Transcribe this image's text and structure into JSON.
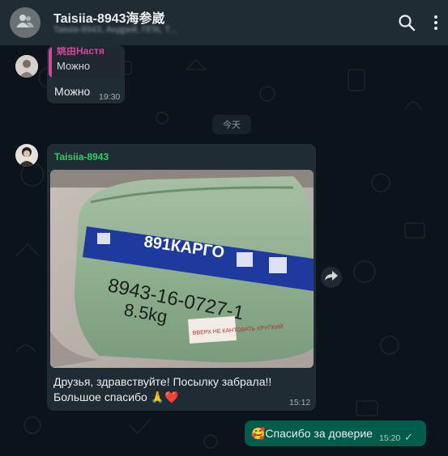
{
  "header": {
    "title": "Taisiia-8943海参崴",
    "subtitle": "Taisiia-8943, Андрей, ППК, Т..."
  },
  "icons": {
    "group_avatar": "group-icon",
    "search": "search-icon",
    "menu": "more-vertical-icon",
    "forward": "forward-icon"
  },
  "messages": {
    "first": {
      "quote_name": "姚由Настя",
      "quote_text": "Можно",
      "text": "Можно",
      "time": "19:30"
    },
    "date_divider": "今天",
    "photo_message": {
      "sender": "Taisiia-8943",
      "photo_label_brand": "891КАРГО",
      "photo_handwriting_line1": "8943-16-0727-1",
      "photo_handwriting_line2": "8.5kg",
      "photo_sticker_text": "ВВЕРХ НЕ КАНТОВАТЬ ХРУПКИЙ",
      "caption_line1": "Друзья, здравствуйте! Посылку забрала!!",
      "caption_line2": "Большое спасибо 🙏❤️",
      "time": "15:12"
    },
    "outgoing": {
      "text": "🥰Спасибо за доверие",
      "time": "15:20",
      "status": "✓"
    }
  },
  "colors": {
    "header_bg": "#202c33",
    "incoming_bg": "#202c33",
    "outgoing_bg": "#005c4b",
    "sender_green": "#25d366",
    "quote_pink": "#d3489d"
  }
}
